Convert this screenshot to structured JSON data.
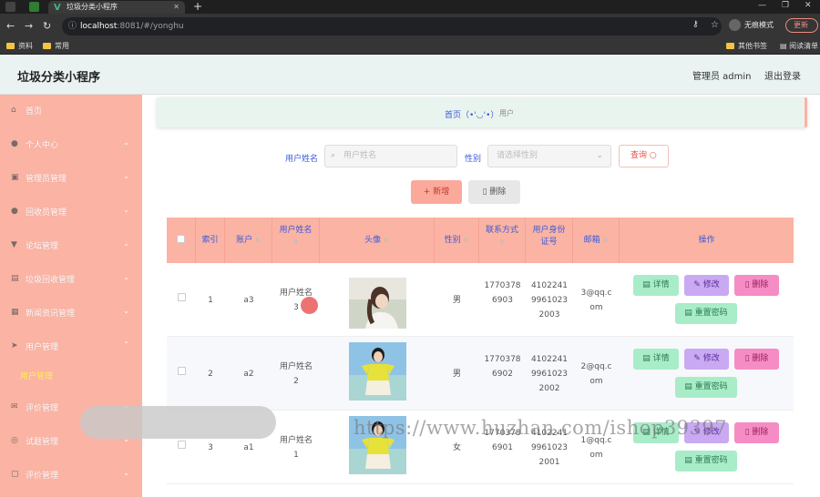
{
  "browser": {
    "tab_title": "垃圾分类小程序",
    "url_host": "localhost",
    "url_path": ":8081/#/yonghu",
    "incognito_label": "无痕模式",
    "update_label": "更新",
    "bookmarks": [
      "资料",
      "常用"
    ],
    "bookmarks_right": [
      "其他书签",
      "阅读清单"
    ]
  },
  "header": {
    "title": "垃圾分类小程序",
    "admin": "管理员 admin",
    "logout": "退出登录"
  },
  "sidebar": {
    "items": [
      {
        "label": "首页",
        "icon": "home-icon",
        "glyph": "⌂"
      },
      {
        "label": "个人中心",
        "icon": "user-icon",
        "glyph": "●"
      },
      {
        "label": "管理员管理",
        "icon": "admin-icon",
        "glyph": "▣"
      },
      {
        "label": "回收员管理",
        "icon": "recycler-icon",
        "glyph": "●"
      },
      {
        "label": "论坛管理",
        "icon": "forum-icon",
        "glyph": "▼"
      },
      {
        "label": "垃圾回收管理",
        "icon": "trash-icon",
        "glyph": "▤"
      },
      {
        "label": "新闻资讯管理",
        "icon": "news-icon",
        "glyph": "▦"
      },
      {
        "label": "用户管理",
        "icon": "send-icon",
        "glyph": "➤"
      },
      {
        "label": "评价管理",
        "icon": "comment-icon",
        "glyph": "✉"
      },
      {
        "label": "试题管理",
        "icon": "exam-icon",
        "glyph": "◎"
      },
      {
        "label": "评价管理",
        "icon": "review-icon",
        "glyph": "▢"
      }
    ],
    "active_sub": "用户管理"
  },
  "breadcrumb": {
    "home": "首页（•'◡'•）",
    "current": "用户"
  },
  "filters": {
    "name_label": "用户姓名",
    "name_placeholder": "用户姓名",
    "gender_label": "性别",
    "gender_placeholder": "请选择性别",
    "query_label": "查询"
  },
  "actions": {
    "add": "+ 新增",
    "delete": "删除"
  },
  "table": {
    "headers": [
      "索引",
      "账户",
      "用户姓名",
      "头像",
      "性别",
      "联系方式",
      "用户身份证号",
      "邮箱",
      "操作"
    ],
    "rows": [
      {
        "index": "1",
        "account": "a3",
        "name": [
          "用户姓名",
          "3"
        ],
        "gender": "男",
        "phone": [
          "1770",
          "378",
          "6903"
        ],
        "idno": [
          "4102241",
          "9961023",
          "2003"
        ],
        "email": [
          "3@qq.c",
          "om"
        ]
      },
      {
        "index": "2",
        "account": "a2",
        "name": [
          "用户姓名",
          "2"
        ],
        "gender": "男",
        "phone": [
          "1770",
          "378",
          "6902"
        ],
        "idno": [
          "4102241",
          "9961023",
          "2002"
        ],
        "email": [
          "2@qq.c",
          "om"
        ]
      },
      {
        "index": "3",
        "account": "a1",
        "name": [
          "用户姓名",
          "1"
        ],
        "gender": "女",
        "phone": [
          "1770",
          "378",
          "6901"
        ],
        "idno": [
          "4102241",
          "9961023",
          "2001"
        ],
        "email": [
          "1@qq.c",
          "om"
        ]
      }
    ],
    "row_buttons": {
      "detail": "详情",
      "edit": "修改",
      "delete": "删除",
      "reset": "重置密码"
    }
  },
  "watermark": "https://www.huzhan.com/ishop39397",
  "colors": {
    "sidebar": "#fbb3a4",
    "header_bg": "#eaf3f1",
    "link_blue": "#3b5bd9",
    "btn_green": "#a9ecc8",
    "btn_purple": "#c9a9f2",
    "btn_pink": "#f58cc4"
  }
}
